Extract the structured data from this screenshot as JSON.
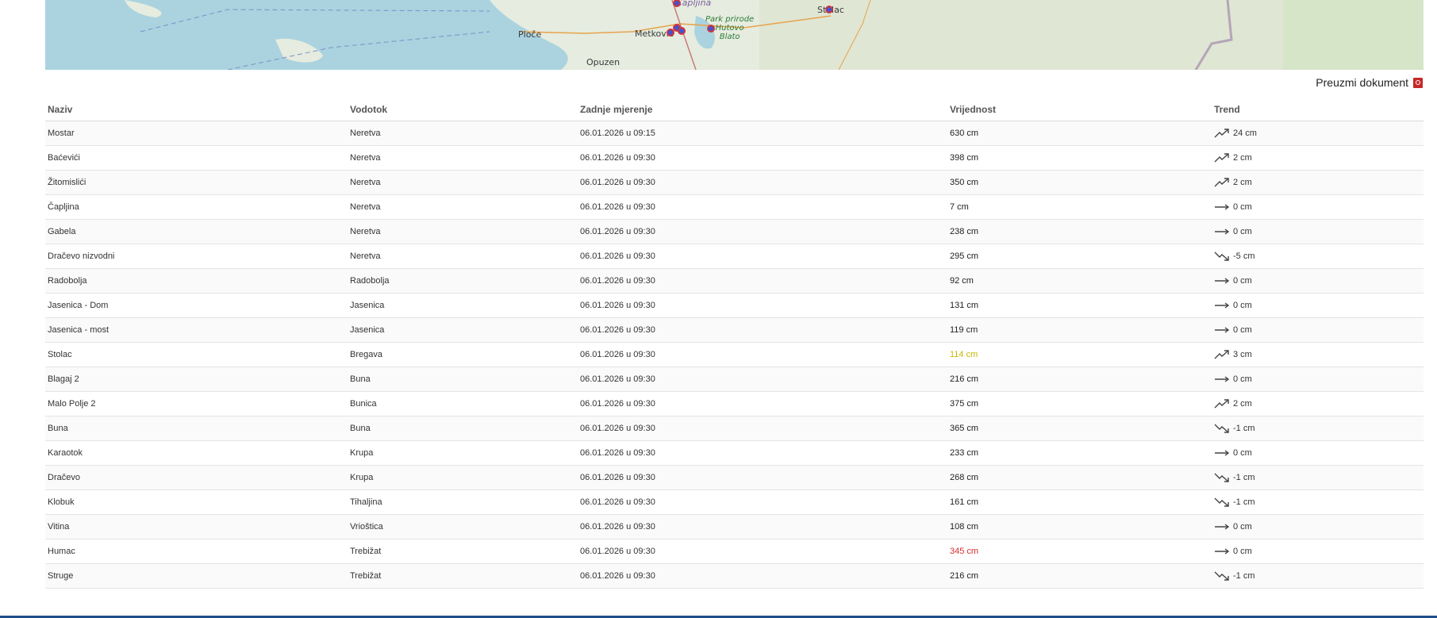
{
  "map": {
    "labels": {
      "ploce": "Ploče",
      "metkovic": "Metković",
      "opuzen": "Opuzen",
      "stolac": "Stolac",
      "capljina": "Čapljina",
      "park": "Park prirode\nHutovo\nBlato"
    },
    "colors": {
      "sea": "#aad3df",
      "land": "#e9efe2",
      "marker_fill": "#3b55d8",
      "marker_border": "#d2333a"
    }
  },
  "download": {
    "label": "Preuzmi dokument",
    "icon": "pdf-icon"
  },
  "table": {
    "headers": [
      "Naziv",
      "Vodotok",
      "Zadnje mjerenje",
      "Vrijednost",
      "Trend"
    ],
    "rows": [
      {
        "name": "Mostar",
        "river": "Neretva",
        "time": "06.01.2026 u 09:15",
        "value": "630 cm",
        "value_color": "#222222",
        "trend": "up",
        "trend_value": "24 cm"
      },
      {
        "name": "Baćevići",
        "river": "Neretva",
        "time": "06.01.2026 u 09:30",
        "value": "398 cm",
        "value_color": "#222222",
        "trend": "up",
        "trend_value": "2 cm"
      },
      {
        "name": "Žitomislići",
        "river": "Neretva",
        "time": "06.01.2026 u 09:30",
        "value": "350 cm",
        "value_color": "#222222",
        "trend": "up",
        "trend_value": "2 cm"
      },
      {
        "name": "Čapljina",
        "river": "Neretva",
        "time": "06.01.2026 u 09:30",
        "value": "7 cm",
        "value_color": "#222222",
        "trend": "flat",
        "trend_value": "0 cm"
      },
      {
        "name": "Gabela",
        "river": "Neretva",
        "time": "06.01.2026 u 09:30",
        "value": "238 cm",
        "value_color": "#222222",
        "trend": "flat",
        "trend_value": "0 cm"
      },
      {
        "name": "Dračevo nizvodni",
        "river": "Neretva",
        "time": "06.01.2026 u 09:30",
        "value": "295 cm",
        "value_color": "#222222",
        "trend": "down",
        "trend_value": "-5 cm"
      },
      {
        "name": "Radobolja",
        "river": "Radobolja",
        "time": "06.01.2026 u 09:30",
        "value": "92 cm",
        "value_color": "#222222",
        "trend": "flat",
        "trend_value": "0 cm"
      },
      {
        "name": "Jasenica - Dom",
        "river": "Jasenica",
        "time": "06.01.2026 u 09:30",
        "value": "131 cm",
        "value_color": "#222222",
        "trend": "flat",
        "trend_value": "0 cm"
      },
      {
        "name": "Jasenica - most",
        "river": "Jasenica",
        "time": "06.01.2026 u 09:30",
        "value": "119 cm",
        "value_color": "#222222",
        "trend": "flat",
        "trend_value": "0 cm"
      },
      {
        "name": "Stolac",
        "river": "Bregava",
        "time": "06.01.2026 u 09:30",
        "value": "114 cm",
        "value_color": "#c9b800",
        "trend": "up",
        "trend_value": "3 cm"
      },
      {
        "name": "Blagaj 2",
        "river": "Buna",
        "time": "06.01.2026 u 09:30",
        "value": "216 cm",
        "value_color": "#222222",
        "trend": "flat",
        "trend_value": "0 cm"
      },
      {
        "name": "Malo Polje 2",
        "river": "Bunica",
        "time": "06.01.2026 u 09:30",
        "value": "375 cm",
        "value_color": "#222222",
        "trend": "up",
        "trend_value": "2 cm"
      },
      {
        "name": "Buna",
        "river": "Buna",
        "time": "06.01.2026 u 09:30",
        "value": "365 cm",
        "value_color": "#222222",
        "trend": "down",
        "trend_value": "-1 cm"
      },
      {
        "name": "Karaotok",
        "river": "Krupa",
        "time": "06.01.2026 u 09:30",
        "value": "233 cm",
        "value_color": "#222222",
        "trend": "flat",
        "trend_value": "0 cm"
      },
      {
        "name": "Dračevo",
        "river": "Krupa",
        "time": "06.01.2026 u 09:30",
        "value": "268 cm",
        "value_color": "#222222",
        "trend": "down",
        "trend_value": "-1 cm"
      },
      {
        "name": "Klobuk",
        "river": "Tihaljina",
        "time": "06.01.2026 u 09:30",
        "value": "161 cm",
        "value_color": "#222222",
        "trend": "down",
        "trend_value": "-1 cm"
      },
      {
        "name": "Vitina",
        "river": "Vrioštica",
        "time": "06.01.2026 u 09:30",
        "value": "108 cm",
        "value_color": "#222222",
        "trend": "flat",
        "trend_value": "0 cm"
      },
      {
        "name": "Humac",
        "river": "Trebižat",
        "time": "06.01.2026 u 09:30",
        "value": "345 cm",
        "value_color": "#d32f2f",
        "trend": "flat",
        "trend_value": "0 cm"
      },
      {
        "name": "Struge",
        "river": "Trebižat",
        "time": "06.01.2026 u 09:30",
        "value": "216 cm",
        "value_color": "#222222",
        "trend": "down",
        "trend_value": "-1 cm"
      }
    ]
  }
}
